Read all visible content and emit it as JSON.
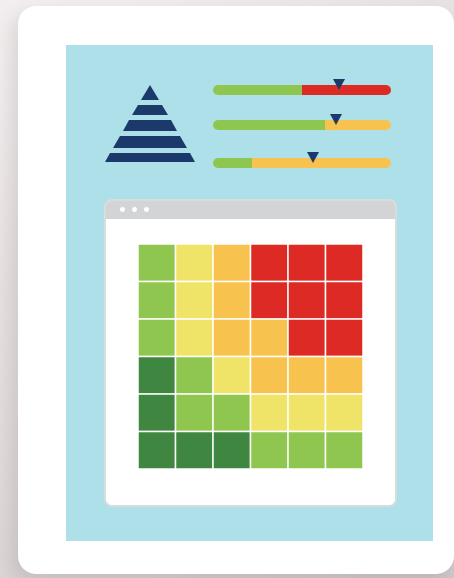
{
  "colors": {
    "panel": "#ade0e8",
    "navy": "#1b3a6b",
    "green": "#8fc64f",
    "dark_green": "#3f8640",
    "yellow": "#f0e468",
    "orange": "#f8c24f",
    "red": "#de2a24",
    "window_bar": "#d3d4d6"
  },
  "icons": {
    "pyramid": "pyramid-icon",
    "window_controls": "window-dots-icon"
  },
  "gauges": [
    {
      "segments": [
        {
          "color": "green",
          "fraction": 0.5
        },
        {
          "color": "red",
          "fraction": 0.5
        }
      ],
      "marker": 0.71
    },
    {
      "segments": [
        {
          "color": "green",
          "fraction": 0.63
        },
        {
          "color": "orange",
          "fraction": 0.37
        }
      ],
      "marker": 0.69
    },
    {
      "segments": [
        {
          "color": "green",
          "fraction": 0.22
        },
        {
          "color": "orange",
          "fraction": 0.78
        }
      ],
      "marker": 0.56
    }
  ],
  "heatmap": {
    "rows": 6,
    "cols": 6,
    "cells": [
      [
        "green",
        "yellow",
        "orange",
        "red",
        "red",
        "red"
      ],
      [
        "green",
        "yellow",
        "orange",
        "red",
        "red",
        "red"
      ],
      [
        "green",
        "yellow",
        "orange",
        "orange",
        "red",
        "red"
      ],
      [
        "dark_green",
        "green",
        "yellow",
        "orange",
        "orange",
        "orange"
      ],
      [
        "dark_green",
        "green",
        "green",
        "yellow",
        "yellow",
        "yellow"
      ],
      [
        "dark_green",
        "dark_green",
        "dark_green",
        "green",
        "green",
        "green"
      ]
    ]
  }
}
